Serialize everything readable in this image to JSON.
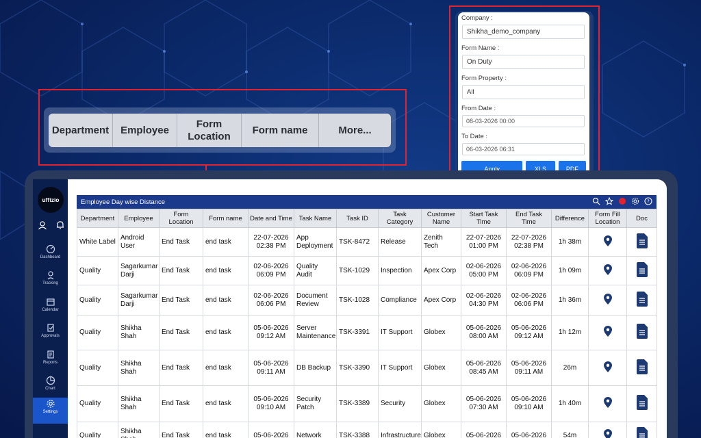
{
  "column_chips": [
    "Department",
    "Employee",
    "Form\nLocation",
    "Form name",
    "More..."
  ],
  "filters": {
    "company_label": "Company :",
    "company_value": "Shikha_demo_company",
    "form_name_label": "Form Name :",
    "form_name_value": "On Duty",
    "form_property_label": "Form Property :",
    "form_property_value": "All",
    "from_date_label": "From Date :",
    "from_date_value": "08-03-2026 00:00",
    "to_date_label": "To Date :",
    "to_date_value": "06-03-2026 06:31",
    "apply": "Apply",
    "xls": "XLS",
    "pdf": "PDF"
  },
  "app": {
    "logo": "uffizio",
    "header_title": "Employee Day wise Distance",
    "nav": [
      "Dashboard",
      "Tracking",
      "Calendar",
      "Approvals",
      "Reports",
      "Chart",
      "Settings"
    ]
  },
  "table": {
    "columns": [
      "Department",
      "Employee",
      "Form Location",
      "Form name",
      "Date and Time",
      "Task Name",
      "Task ID",
      "Task Category",
      "Customer Name",
      "Start Task Time",
      "End Task Time",
      "Difference",
      "Form Fill Location",
      "Doc"
    ],
    "rows": [
      [
        "White Label",
        "Android User",
        "End Task",
        "end task",
        "22-07-2026\n02:38 PM",
        "App\nDeployment",
        "TSK-8472",
        "Release",
        "Zenith Tech",
        "22-07-2026\n01:00 PM",
        "22-07-2026\n02:38 PM",
        "1h 38m"
      ],
      [
        "Quality",
        "Sagarkumar\nDarji",
        "End Task",
        "end task",
        "02-06-2026\n06:09 PM",
        "Quality Audit",
        "TSK-1029",
        "Inspection",
        "Apex Corp",
        "02-06-2026\n05:00 PM",
        "02-06-2026\n06:09 PM",
        "1h 09m"
      ],
      [
        "Quality",
        "Sagarkumar\nDarji",
        "End Task",
        "end task",
        "02-06-2026\n06:06 PM",
        "Document\nReview",
        "TSK-1028",
        "Compliance",
        "Apex Corp",
        "02-06-2026\n04:30 PM",
        "02-06-2026\n06:06 PM",
        "1h 36m"
      ],
      [
        "Quality",
        "Shikha Shah",
        "End Task",
        "end task",
        "05-06-2026\n09:12 AM",
        "Server\nMaintenance",
        "TSK-3391",
        "IT Support",
        "Globex",
        "05-06-2026\n08:00 AM",
        "05-06-2026\n09:12 AM",
        "1h 12m"
      ],
      [
        "Quality",
        "Shikha Shah",
        "End Task",
        "end task",
        "05-06-2026\n09:11 AM",
        "DB Backup",
        "TSK-3390",
        "IT Support",
        "Globex",
        "05-06-2026\n08:45 AM",
        "05-06-2026\n09:11 AM",
        "26m"
      ],
      [
        "Quality",
        "Shikha Shah",
        "End Task",
        "end task",
        "05-06-2026\n09:10 AM",
        "Security\nPatch",
        "TSK-3389",
        "Security",
        "Globex",
        "05-06-2026\n07:30 AM",
        "05-06-2026\n09:10 AM",
        "1h 40m"
      ],
      [
        "Quality",
        "Shikha Shah",
        "End Task",
        "end task",
        "05-06-2026",
        "Network",
        "TSK-3388",
        "Infrastructure",
        "Globex",
        "05-06-2026",
        "05-06-2026",
        "54m"
      ]
    ]
  }
}
